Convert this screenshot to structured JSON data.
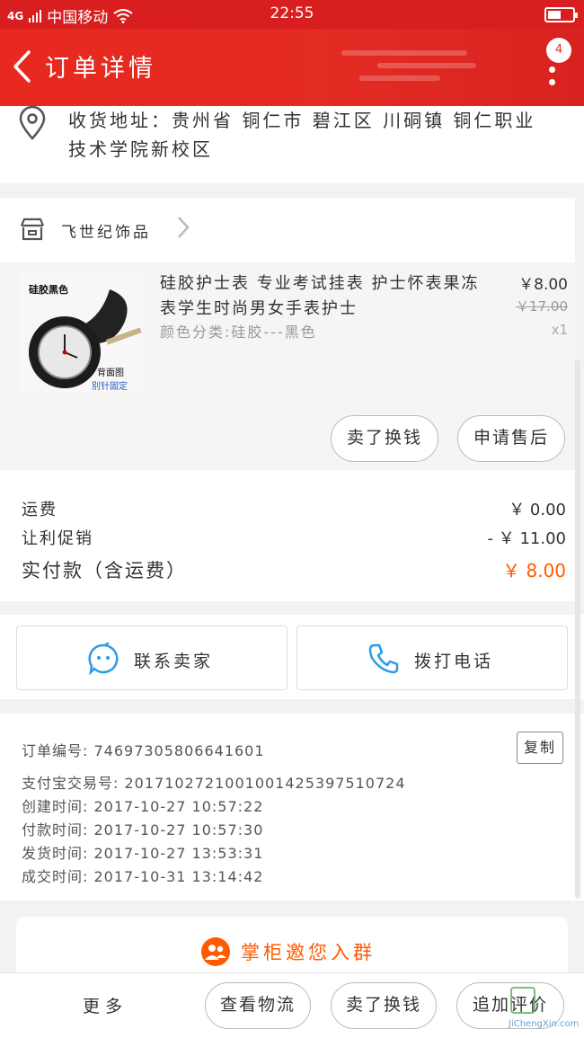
{
  "status_bar": {
    "signal": "4G",
    "carrier": "中国移动",
    "time": "22:55"
  },
  "nav": {
    "title": "订单详情",
    "badge": "4"
  },
  "address": {
    "text": "收货地址：贵州省 铜仁市 碧江区 川硐镇 铜仁职业技术学院新校区"
  },
  "shop": {
    "name": "飞世纪饰品"
  },
  "product": {
    "image_label_top": "硅胶黑色",
    "image_label_bottom": "背面图",
    "image_label_pin": "别针固定",
    "title": "硅胶护士表 专业考试挂表 护士怀表果冻表学生时尚男女手表护士",
    "spec": "颜色分类:硅胶---黑色",
    "price": "￥8.00",
    "original_price": "￥17.00",
    "quantity": "x1",
    "actions": [
      "卖了换钱",
      "申请售后"
    ]
  },
  "costs": {
    "shipping_label": "运费",
    "shipping_value": "￥ 0.00",
    "discount_label": "让利促销",
    "discount_value": "- ￥ 11.00",
    "total_label": "实付款（含运费）",
    "total_value": "￥ 8.00"
  },
  "contact": {
    "seller_label": "联系卖家",
    "phone_label": "拨打电话"
  },
  "order_info": {
    "order_no": "订单编号: 74697305806641601",
    "copy_label": "复制",
    "alipay_no": "支付宝交易号: 2017102721001001425397510724",
    "created": "创建时间: 2017-10-27  10:57:22",
    "paid": "付款时间: 2017-10-27  10:57:30",
    "shipped": "发货时间: 2017-10-27  13:53:31",
    "completed": "成交时间: 2017-10-31  13:14:42"
  },
  "group_invite": {
    "label": "掌柜邀您入群"
  },
  "bottom_bar": {
    "more_label": "更多",
    "logistics_label": "查看物流",
    "resell_label": "卖了换钱",
    "review_label": "追加评价"
  },
  "watermark": {
    "text": "JiChengXin.com"
  },
  "colors": {
    "brand_red": "#e32b24",
    "price_orange": "#ff5a00",
    "contact_blue": "#2a9be8"
  }
}
